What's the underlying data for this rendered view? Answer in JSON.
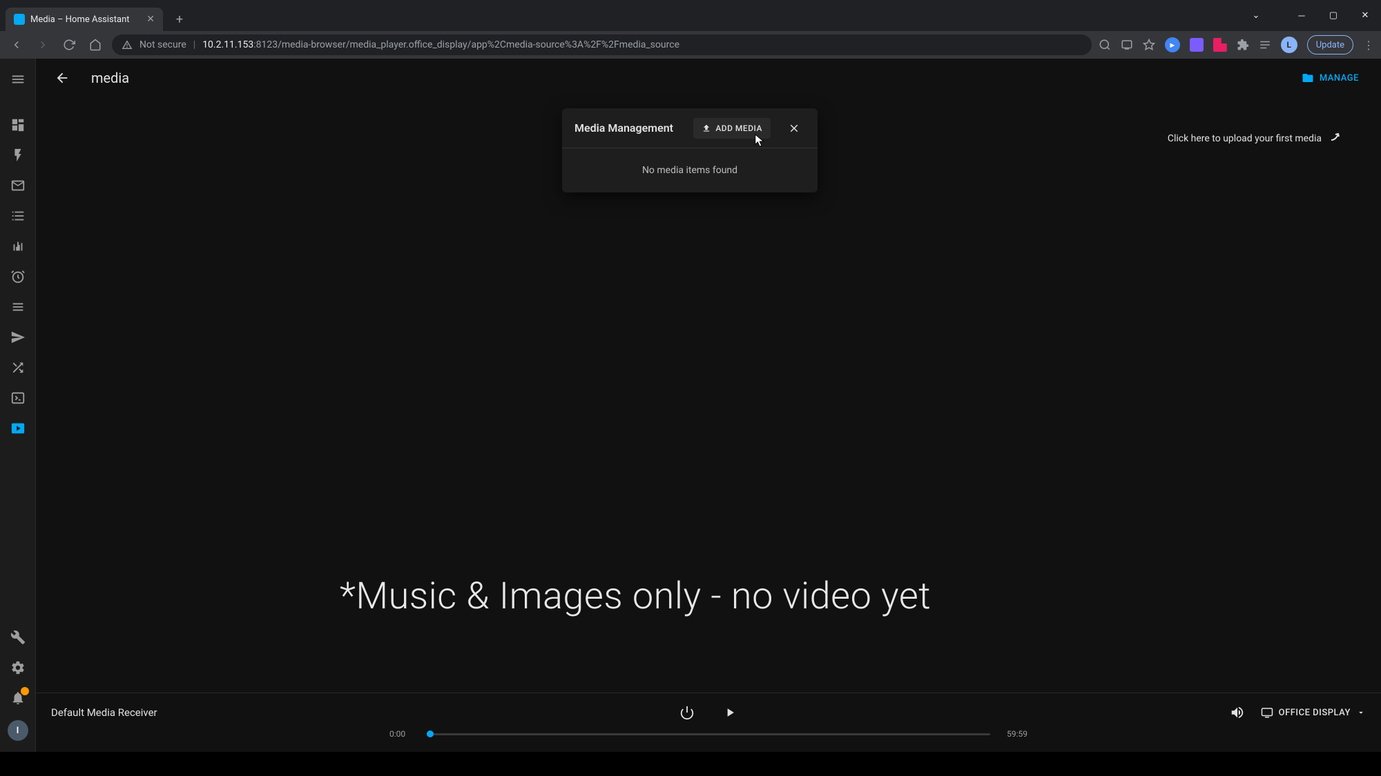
{
  "browser": {
    "tab_title": "Media – Home Assistant",
    "not_secure": "Not secure",
    "url_host": "10.2.11.153",
    "url_rest": ":8123/media-browser/media_player.office_display/app%2Cmedia-source%3A%2F%2Fmedia_source",
    "update_label": "Update"
  },
  "header": {
    "title": "media",
    "manage_label": "MANAGE"
  },
  "hint": {
    "text": "Click here to upload your first media"
  },
  "modal": {
    "title": "Media Management",
    "add_label": "ADD MEDIA",
    "body": "No media items found"
  },
  "overlay": {
    "text": "*Music & Images only - no video yet"
  },
  "player": {
    "title": "Default Media Receiver",
    "time_current": "0:00",
    "time_total": "59:59",
    "device_label": "OFFICE DISPLAY"
  },
  "avatar_letter": "I"
}
